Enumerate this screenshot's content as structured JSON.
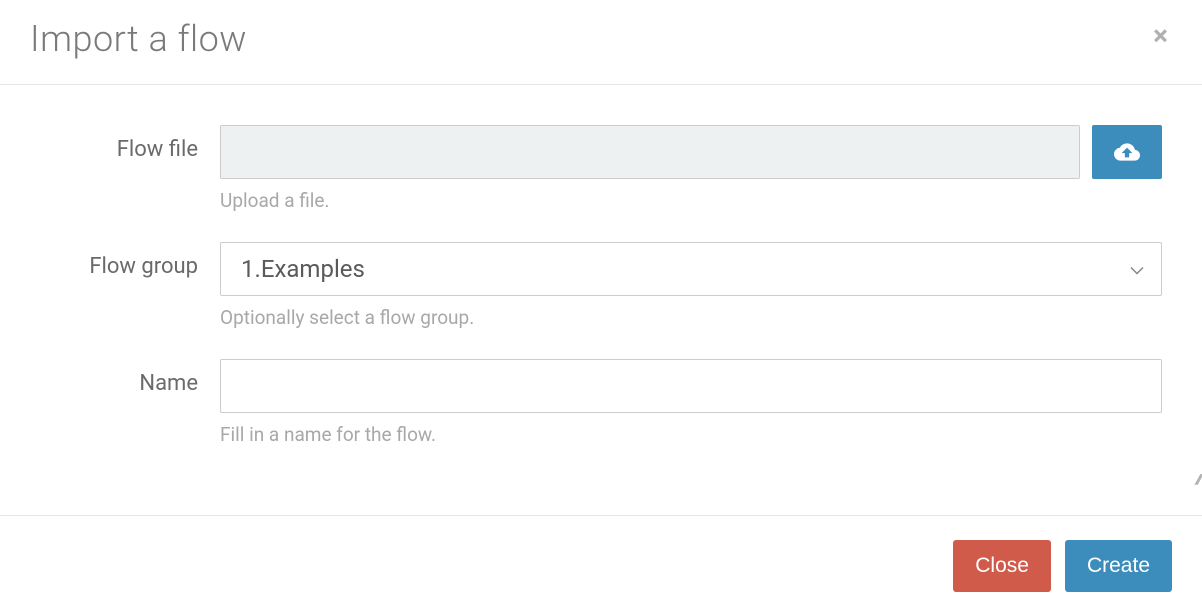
{
  "header": {
    "title": "Import a flow"
  },
  "form": {
    "flowFile": {
      "label": "Flow file",
      "value": "",
      "help": "Upload a file.",
      "uploadIconName": "cloud-upload-icon"
    },
    "flowGroup": {
      "label": "Flow group",
      "selected": "1.Examples",
      "help": "Optionally select a flow group."
    },
    "name": {
      "label": "Name",
      "value": "",
      "help": "Fill in a name for the flow."
    }
  },
  "footer": {
    "closeLabel": "Close",
    "createLabel": "Create"
  },
  "colors": {
    "primary": "#3d8dbc",
    "danger": "#d05b4b"
  }
}
